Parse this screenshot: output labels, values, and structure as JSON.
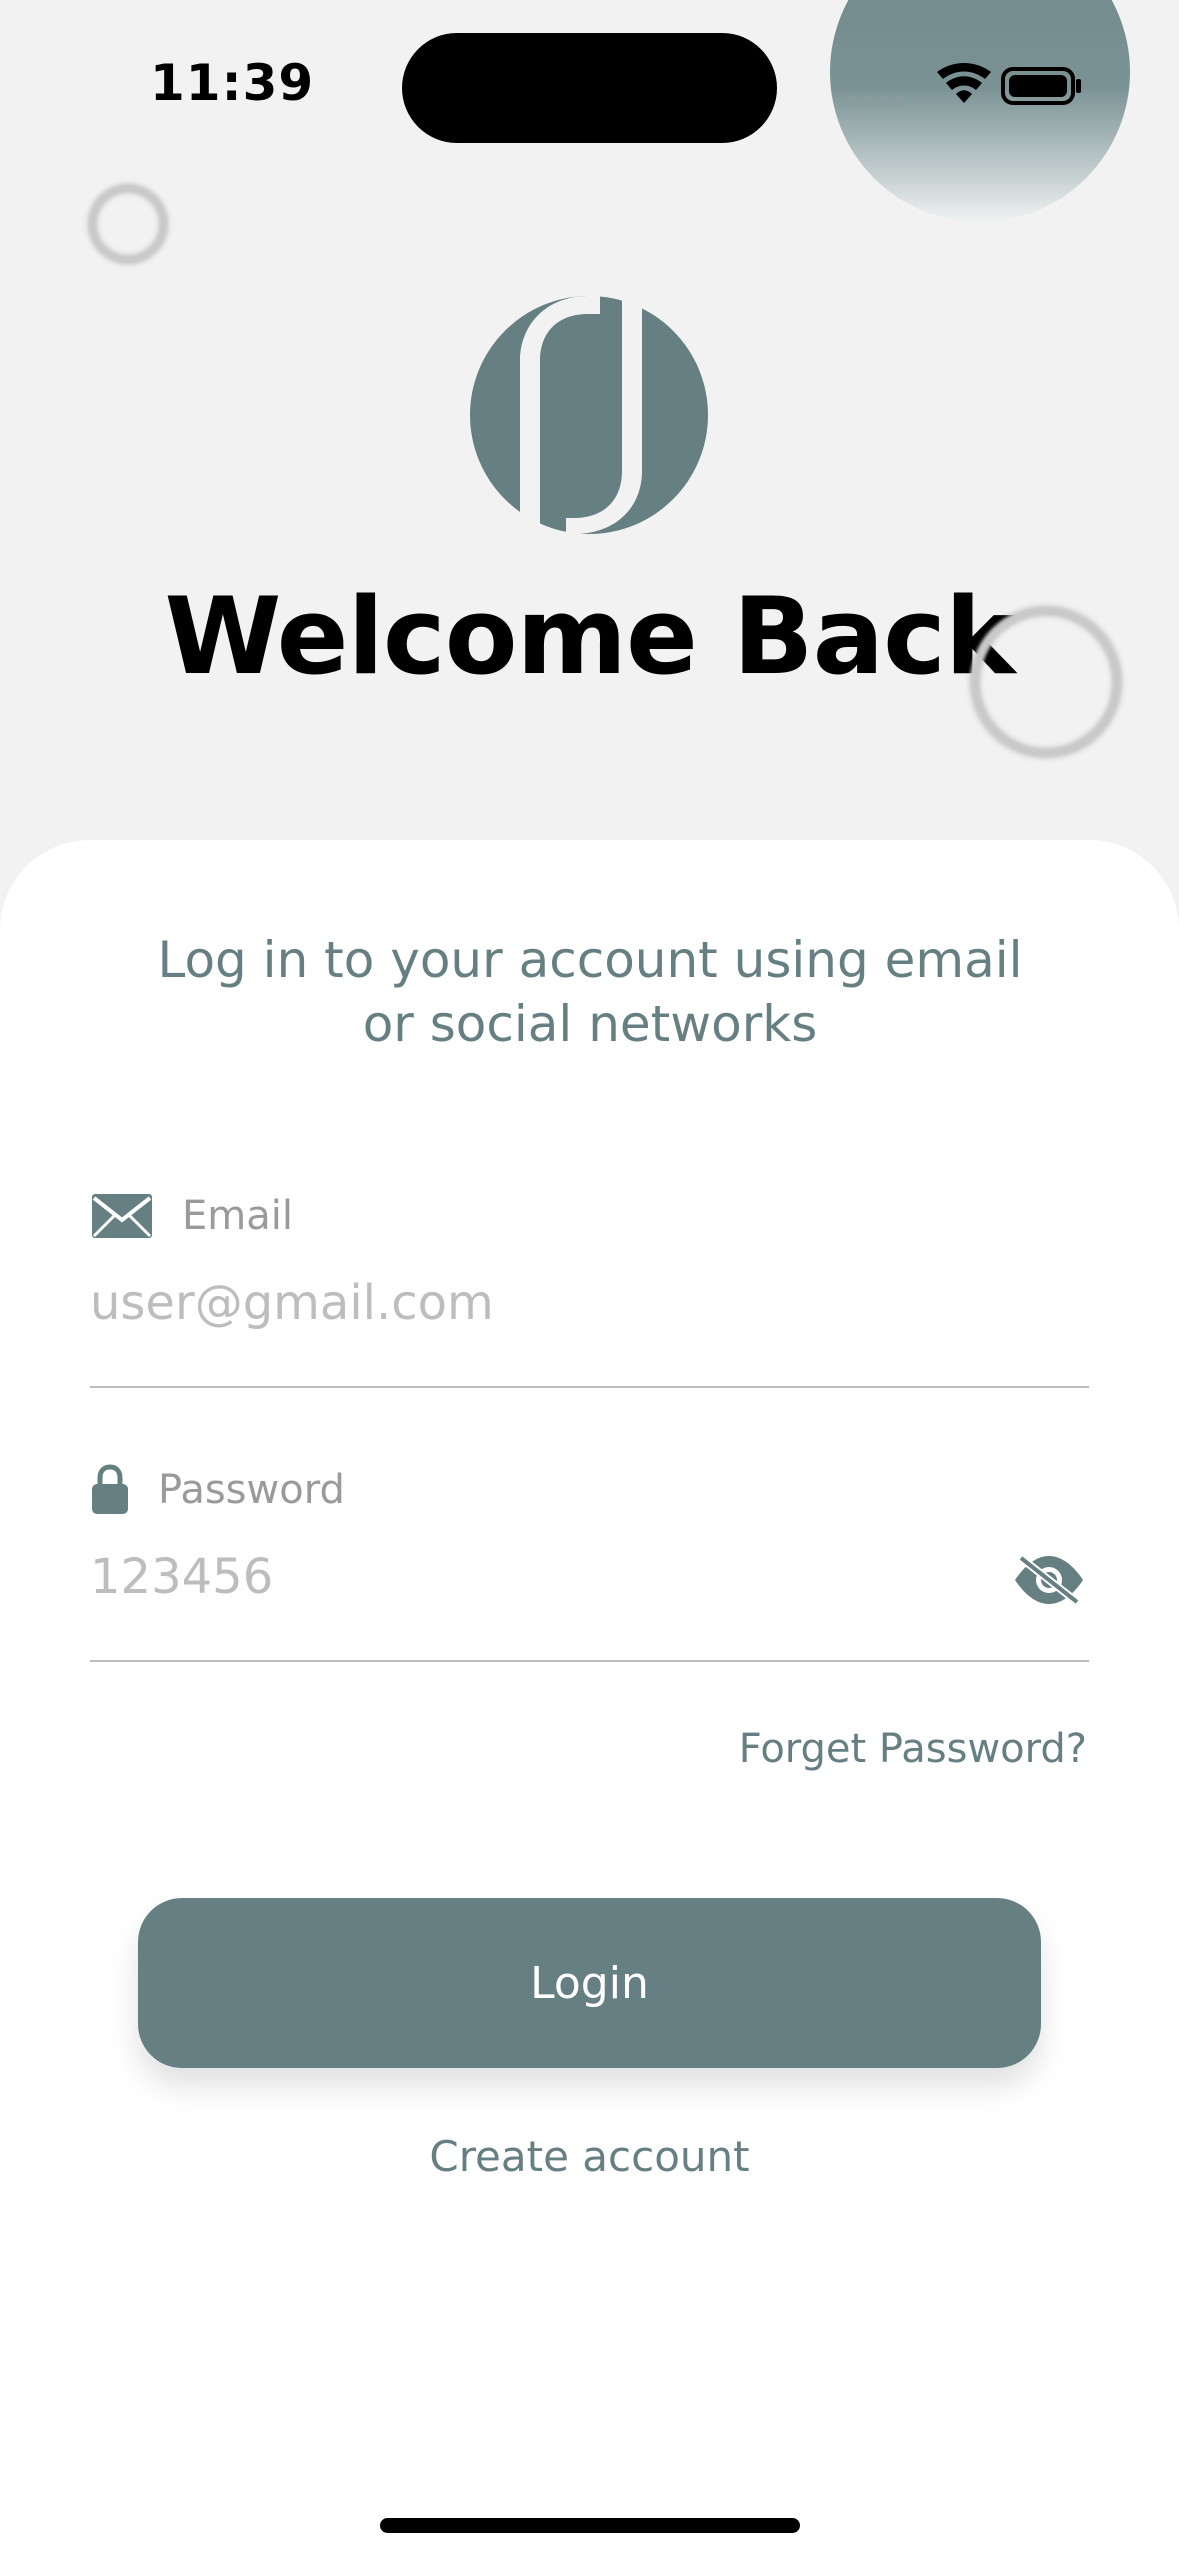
{
  "status_bar": {
    "time": "11:39"
  },
  "header": {
    "title": "Welcome Back"
  },
  "card": {
    "subtitle_line1": "Log in to your account using email",
    "subtitle_line2": "or social networks"
  },
  "form": {
    "email": {
      "label": "Email",
      "placeholder": "user@gmail.com",
      "value": ""
    },
    "password": {
      "label": "Password",
      "placeholder": "123456",
      "value": ""
    },
    "forgot_label": "Forget Password?",
    "login_label": "Login",
    "create_account_label": "Create account"
  },
  "colors": {
    "accent": "#667f82",
    "background": "#f2f2f2",
    "card": "#ffffff"
  },
  "icons": {
    "email": "envelope-icon",
    "password": "lock-icon",
    "toggle": "eye-slash-icon"
  }
}
